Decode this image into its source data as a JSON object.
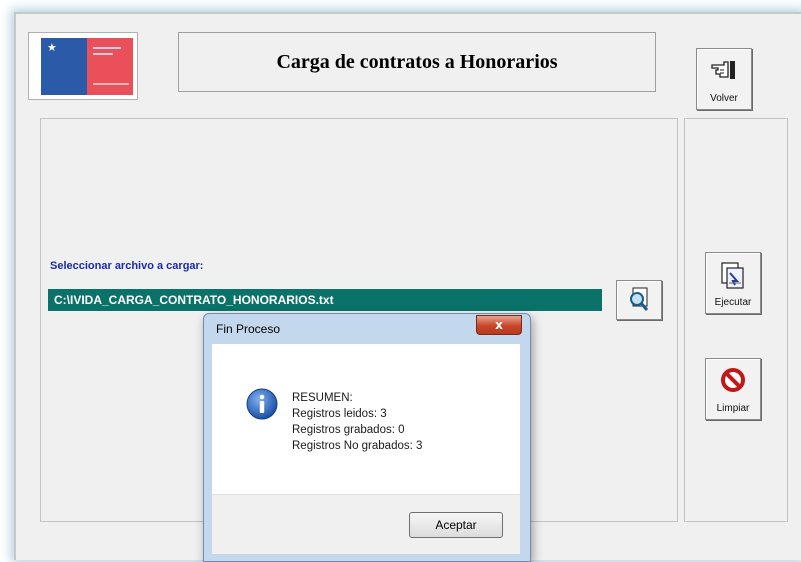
{
  "app": {
    "title": "Carga de contratos a Honorarios"
  },
  "buttons": {
    "volver": "Volver",
    "ejecutar": "Ejecutar",
    "limpiar": "Limpiar"
  },
  "file": {
    "label": "Seleccionar archivo a cargar:",
    "path": "C:\\IVIDA_CARGA_CONTRATO_HONORARIOS.txt"
  },
  "dialog": {
    "title": "Fin Proceso",
    "close": "x",
    "lines": [
      "RESUMEN:",
      "Registros leidos: 3",
      "Registros grabados: 0",
      "Registros No grabados: 3"
    ],
    "ok": "Aceptar"
  },
  "colors": {
    "path_bg": "#0a7268",
    "label_text": "#1a2aa8",
    "logo_blue": "#2a5aa8",
    "logo_red": "#e9505a"
  },
  "icons": {
    "volver": "pointing-hand-icon",
    "ejecutar": "execute-document-icon",
    "limpiar": "no-entry-icon",
    "browse": "magnifier-icon",
    "info": "info-icon"
  }
}
